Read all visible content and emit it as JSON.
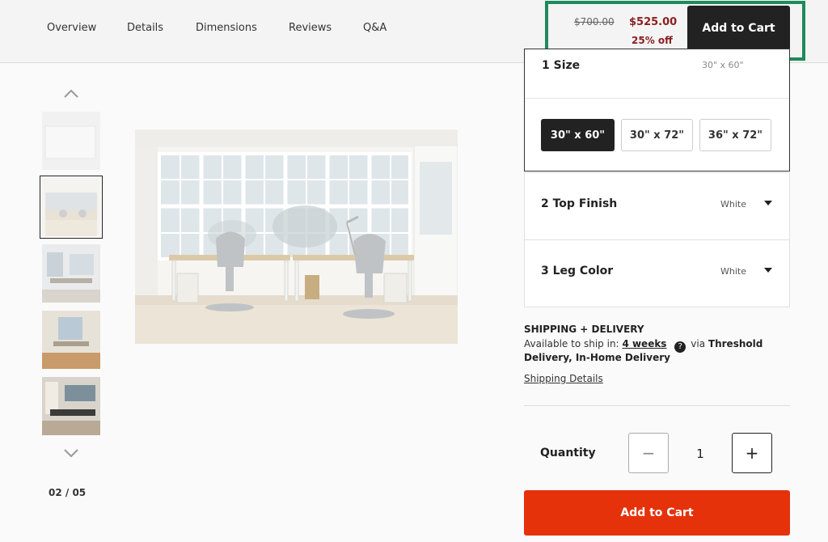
{
  "nav": {
    "links": [
      "Overview",
      "Details",
      "Dimensions",
      "Reviews",
      "Q&A"
    ]
  },
  "sticky": {
    "old_price": "$700.00",
    "new_price": "$525.00",
    "discount": "25% off",
    "add_to_cart": "Add to Cart",
    "highlight_color": "#1f8a5b"
  },
  "gallery": {
    "counter": "02 / 05",
    "active_index": 2
  },
  "options": {
    "size": {
      "label": "1  Size",
      "value": "30\" x 60\"",
      "choices": [
        "30\" x 60\"",
        "30\" x 72\"",
        "36\" x 72\""
      ],
      "selected": "30\" x 60\""
    },
    "top_finish": {
      "label": "2  Top Finish",
      "value": "White"
    },
    "leg_color": {
      "label": "3  Leg Color",
      "value": "White"
    }
  },
  "shipping": {
    "title": "SHIPPING + DELIVERY",
    "available_prefix": "Available to ship in:",
    "lead_time": "4 weeks",
    "via": "via",
    "method_part1": "Threshold",
    "method_part2": "Delivery, In-Home Delivery",
    "details_link": "Shipping Details"
  },
  "quantity": {
    "label": "Quantity",
    "value": "1",
    "minus": "−",
    "plus": "+"
  },
  "cta": {
    "add_to_cart": "Add to Cart",
    "color": "#e5320b"
  }
}
